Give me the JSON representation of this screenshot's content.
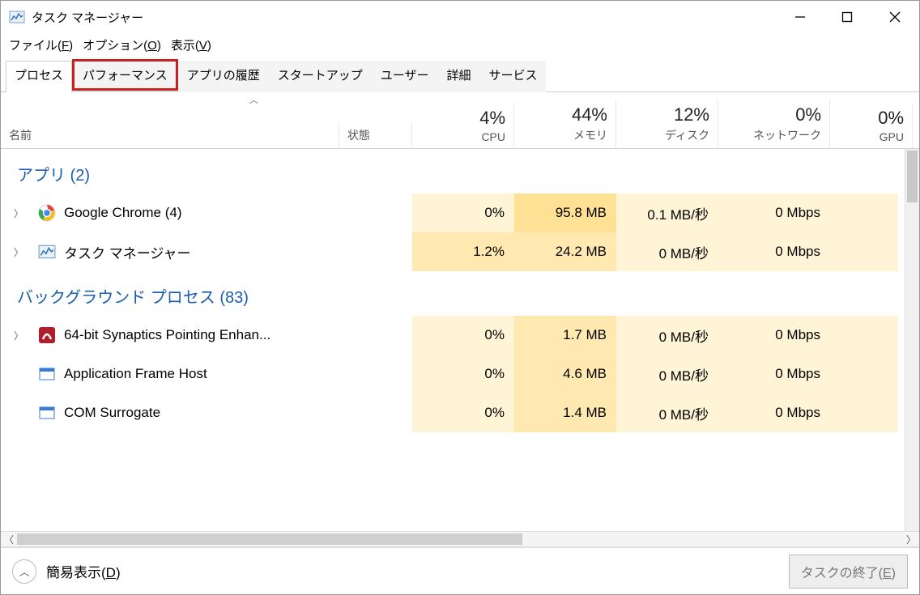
{
  "window": {
    "title": "タスク マネージャー"
  },
  "menu": {
    "file": "ファイル(",
    "file_key": "F",
    "file_close": ")",
    "options": "オプション(",
    "options_key": "O",
    "options_close": ")",
    "view": "表示(",
    "view_key": "V",
    "view_close": ")"
  },
  "tabs": {
    "processes": "プロセス",
    "performance": "パフォーマンス",
    "history": "アプリの履歴",
    "startup": "スタートアップ",
    "users": "ユーザー",
    "details": "詳細",
    "services": "サービス"
  },
  "columns": {
    "name": "名前",
    "status": "状態",
    "cpu_pct": "4%",
    "cpu_lbl": "CPU",
    "mem_pct": "44%",
    "mem_lbl": "メモリ",
    "disk_pct": "12%",
    "disk_lbl": "ディスク",
    "net_pct": "0%",
    "net_lbl": "ネットワーク",
    "gpu_pct": "0%",
    "gpu_lbl": "GPU"
  },
  "groups": {
    "apps": "アプリ (2)",
    "background": "バックグラウンド プロセス (83)"
  },
  "rows": {
    "chrome": {
      "name": "Google Chrome (4)",
      "cpu": "0%",
      "mem": "95.8 MB",
      "disk": "0.1 MB/秒",
      "net": "0 Mbps"
    },
    "taskmgr": {
      "name": "タスク マネージャー",
      "cpu": "1.2%",
      "mem": "24.2 MB",
      "disk": "0 MB/秒",
      "net": "0 Mbps"
    },
    "synaptics": {
      "name": "64-bit Synaptics Pointing Enhan...",
      "cpu": "0%",
      "mem": "1.7 MB",
      "disk": "0 MB/秒",
      "net": "0 Mbps"
    },
    "afh": {
      "name": "Application Frame Host",
      "cpu": "0%",
      "mem": "4.6 MB",
      "disk": "0 MB/秒",
      "net": "0 Mbps"
    },
    "com": {
      "name": "COM Surrogate",
      "cpu": "0%",
      "mem": "1.4 MB",
      "disk": "0 MB/秒",
      "net": "0 Mbps"
    }
  },
  "footer": {
    "simple": "簡易表示(",
    "simple_key": "D",
    "simple_close": ")",
    "endtask": "タスクの終了(",
    "endtask_key": "E",
    "endtask_close": ")"
  }
}
